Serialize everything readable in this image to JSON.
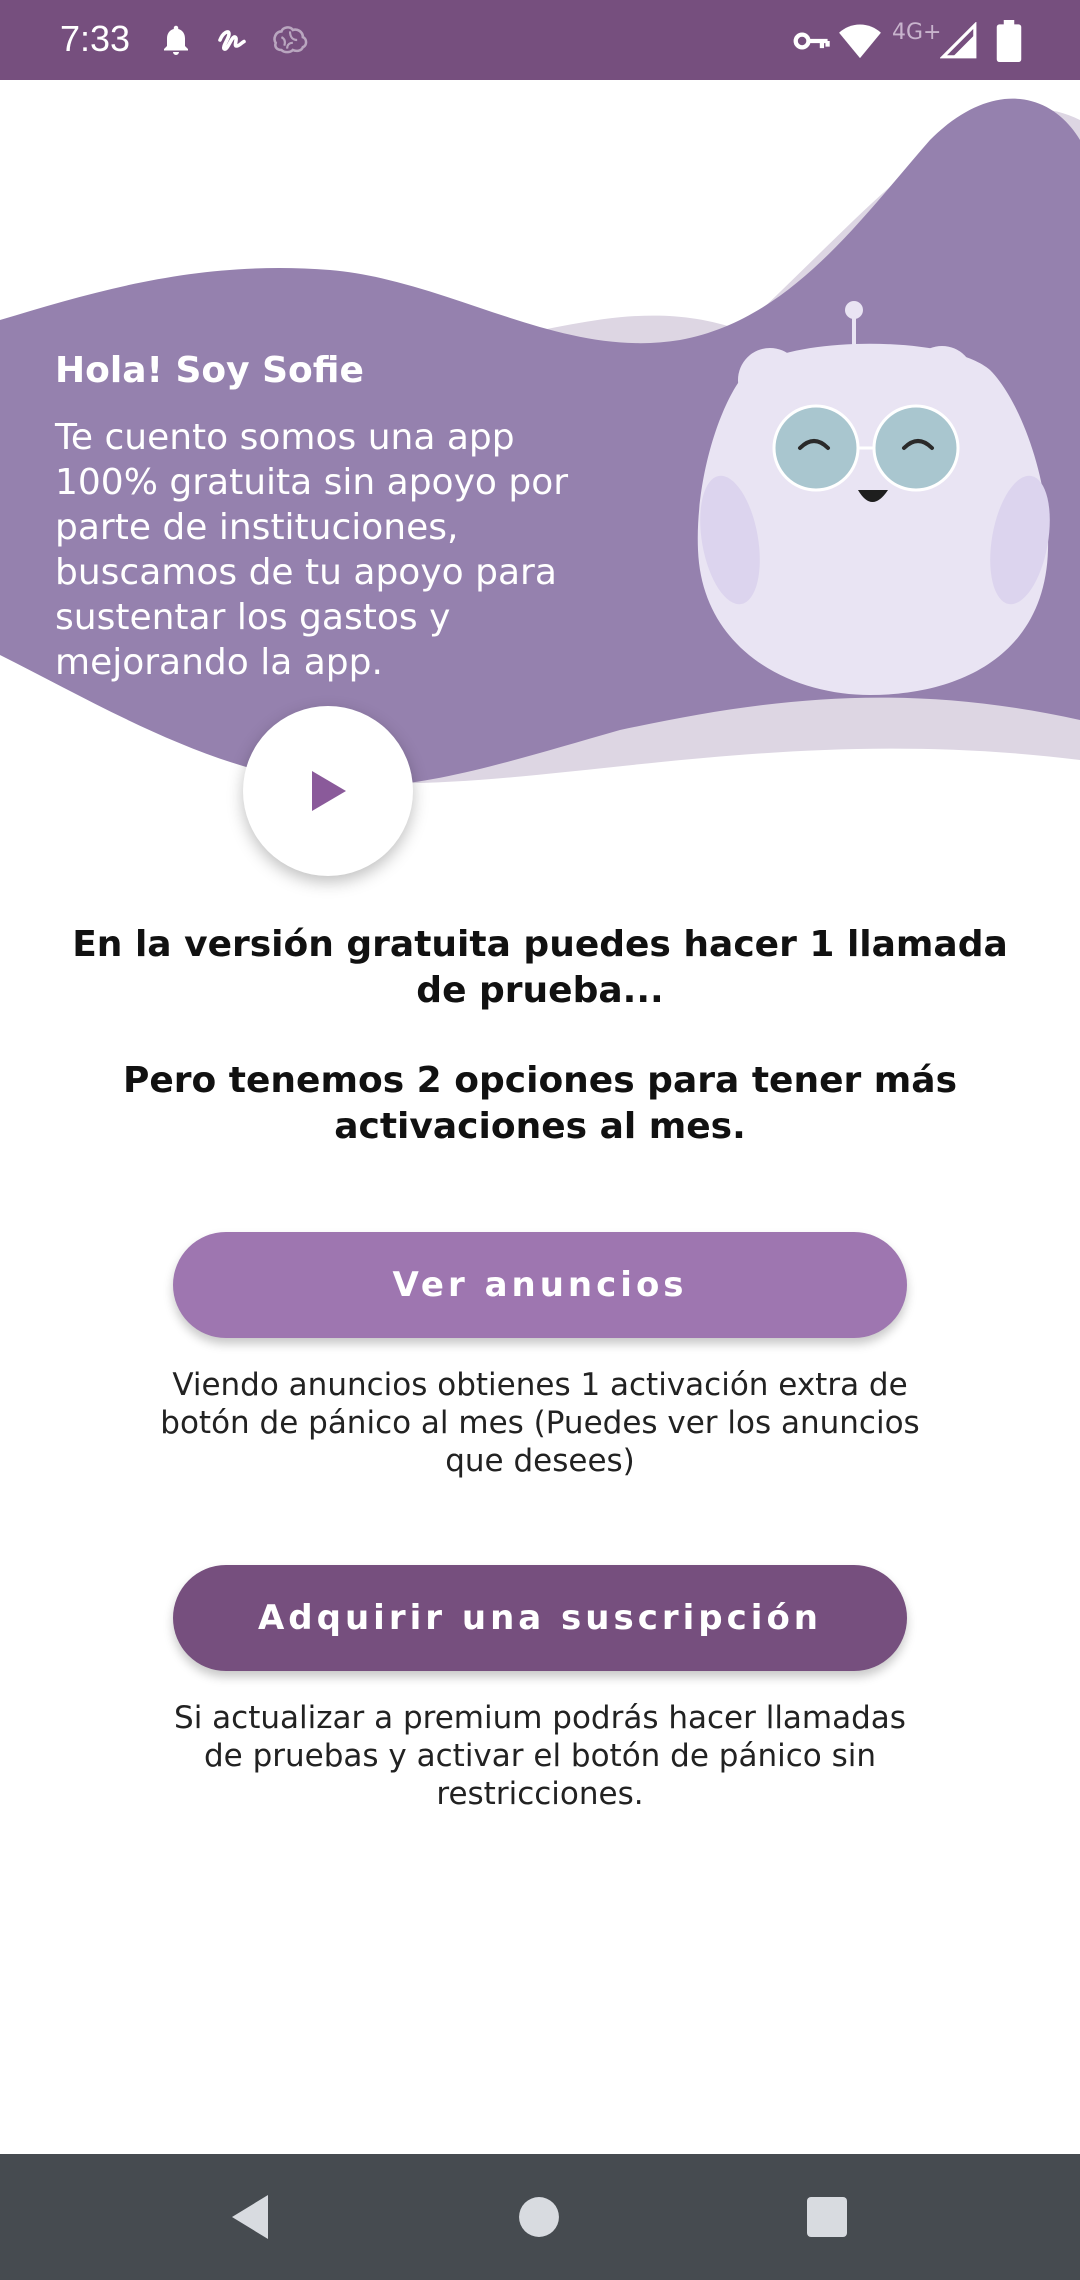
{
  "status_bar": {
    "time": "7:33",
    "network_label": "4G+",
    "left_icons": [
      "bell-icon",
      "signature-icon",
      "brain-icon"
    ],
    "right_icons": [
      "key-icon",
      "wifi-icon",
      "cell-signal-icon",
      "battery-icon"
    ]
  },
  "hero": {
    "title": "Hola! Soy Sofie",
    "text": "Te cuento somos una app 100% gratuita sin apoyo por parte de instituciones, buscamos de tu apoyo para sustentar los gastos y mejorando la app.",
    "play_icon": "play-icon",
    "mascot": "sofie-mascot"
  },
  "main": {
    "headline_1": "En la versión gratuita puedes hacer 1 llamada de prueba...",
    "headline_2": "Pero tenemos 2 opciones para tener más activaciones al mes.",
    "ads_button_label": "Ver anuncios",
    "ads_description": "Viendo anuncios obtienes 1 activación extra de botón de pánico al mes (Puedes ver los anuncios que desees)",
    "subscription_button_label": "Adquirir una suscripción",
    "subscription_description": "Si actualizar a premium podrás hacer llamadas de pruebas y activar el botón de pánico sin restricciones."
  },
  "nav_bar": {
    "icons": [
      "back-icon",
      "home-icon",
      "recents-icon"
    ]
  },
  "colors": {
    "status_bar": "#764f7e",
    "hero_wave": "#9581ae",
    "hero_wave_shadow": "#ddd6e3",
    "button_ads": "#9e76b0",
    "button_subscription": "#764f7e",
    "nav_bar": "#464b50",
    "play_icon": "#8a5a9a"
  }
}
